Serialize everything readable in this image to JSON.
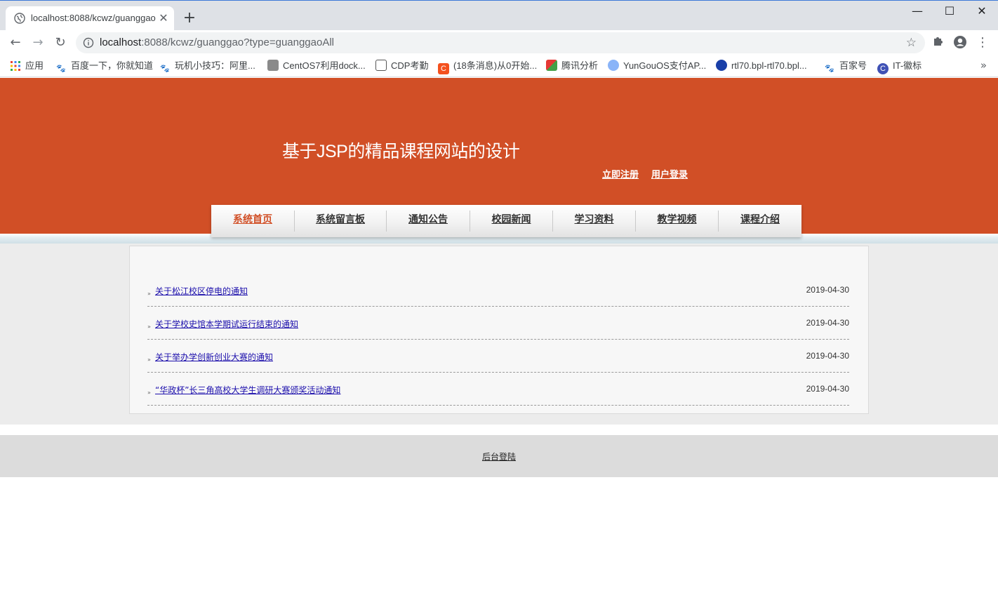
{
  "browser": {
    "tab_title": "localhost:8088/kcwz/guanggao?type=guanggaoAll",
    "tab_close": "✕",
    "new_tab": "+",
    "url_host": "localhost",
    "url_rest": ":8088/kcwz/guanggao?type=guanggaoAll",
    "window_controls": {
      "minimize": "—",
      "maximize": "☐",
      "close": "✕"
    },
    "nav": {
      "back": "←",
      "forward": "→",
      "reload": "↻"
    },
    "bookmarks": [
      {
        "label": "应用",
        "icon": "apps-grid-icon",
        "color": "#4285f4"
      },
      {
        "label": "百度一下，你就知道",
        "icon": "baidu-paw-icon",
        "color": "#2932e1"
      },
      {
        "label": "玩机小技巧：阿里...",
        "icon": "baidu-paw-icon",
        "color": "#2932e1"
      },
      {
        "label": "CentOS7利用dock...",
        "icon": "image-icon",
        "color": "#777777"
      },
      {
        "label": "CDP考勤",
        "icon": "image-icon",
        "color": "#555555"
      },
      {
        "label": "(18条消息)从0开始...",
        "icon": "csdn-icon",
        "color": "#f4511e"
      },
      {
        "label": "腾讯分析",
        "icon": "tencent-pinwheel-icon",
        "color": "#e53935"
      },
      {
        "label": "YunGouOS支付AP...",
        "icon": "globe-icon",
        "color": "#8ab4f8"
      },
      {
        "label": "rtl70.bpl-rtl70.bpl...",
        "icon": "feather-icon",
        "color": "#f9ab00"
      },
      {
        "label": "百家号",
        "icon": "baidu-paw-icon",
        "color": "#2932e1"
      },
      {
        "label": "IT-徽标",
        "icon": "circle-c-icon",
        "color": "#3f51b5"
      }
    ],
    "bookmarks_more": "»"
  },
  "site": {
    "title": "基于JSP的精品课程网站的设计",
    "register_link": "立即注册",
    "login_link": "用户登录",
    "accent_color": "#d14f26",
    "nav": [
      {
        "label": "系统首页",
        "active": true
      },
      {
        "label": "系统留言板",
        "active": false
      },
      {
        "label": "通知公告",
        "active": false
      },
      {
        "label": "校园新闻",
        "active": false
      },
      {
        "label": "学习资料",
        "active": false
      },
      {
        "label": "教学视频",
        "active": false
      },
      {
        "label": "课程介绍",
        "active": false
      }
    ],
    "announcements": [
      {
        "title": "关于松江校区停电的通知",
        "date": "2019-04-30"
      },
      {
        "title": "关于学校史馆本学期试运行结束的通知",
        "date": "2019-04-30"
      },
      {
        "title": "关于举办学创新创业大赛的通知",
        "date": "2019-04-30"
      },
      {
        "title": "“华政杯”长三角高校大学生调研大赛颁奖活动通知",
        "date": "2019-04-30"
      }
    ],
    "footer_link": "后台登陆"
  }
}
